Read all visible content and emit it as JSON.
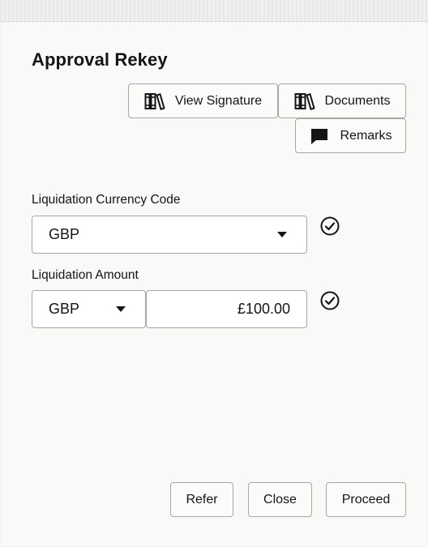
{
  "dialog": {
    "title": "Approval Rekey"
  },
  "actions": {
    "view_signature": {
      "label": "View Signature",
      "icon": "books-icon"
    },
    "documents": {
      "label": "Documents",
      "icon": "books-icon"
    },
    "remarks": {
      "label": "Remarks",
      "icon": "speech-bubble-icon"
    }
  },
  "form": {
    "liquidation_currency_code": {
      "label": "Liquidation Currency Code",
      "value": "GBP",
      "status_icon": "check-circle-icon"
    },
    "liquidation_amount": {
      "label": "Liquidation Amount",
      "currency": "GBP",
      "amount": "£100.00",
      "status_icon": "check-circle-icon"
    }
  },
  "footer": {
    "refer_label": "Refer",
    "close_label": "Close",
    "proceed_label": "Proceed"
  }
}
